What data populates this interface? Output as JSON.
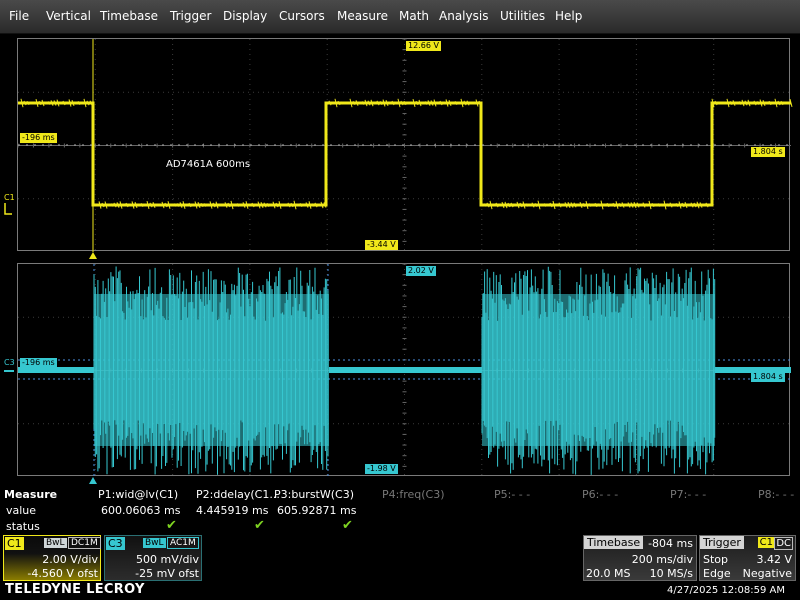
{
  "menu": [
    "File",
    "Vertical",
    "Timebase",
    "Trigger",
    "Display",
    "Cursors",
    "Measure",
    "Math",
    "Analysis",
    "Utilities",
    "Help"
  ],
  "grid1": {
    "top_level_label": "12.66 V",
    "bottom_level_label": "-3.44 V",
    "left_time_label": "-196 ms",
    "right_time_label": "1.804 s",
    "annotation": "AD7461A 600ms",
    "channel_tag": "C1",
    "color": "#f0e81a"
  },
  "grid2": {
    "top_level_label": "2.02 V",
    "bottom_level_label": "-1.98 V",
    "left_time_label": "-196 ms",
    "right_time_label": "1.804 s",
    "channel_tag": "C3",
    "color": "#36c7d0"
  },
  "measure": {
    "title": "Measure",
    "row_value": "value",
    "row_status": "status",
    "params": [
      {
        "name": "P1:wid@lv(C1)",
        "value": "600.06063 ms",
        "status": "✔"
      },
      {
        "name": "P2:ddelay(C1...",
        "value": "4.445919 ms",
        "status": "✔"
      },
      {
        "name": "P3:burstW(C3)",
        "value": "605.92871 ms",
        "status": "✔"
      },
      {
        "name": "P4:freq(C3)",
        "value": "",
        "status": ""
      },
      {
        "name": "P5:- - -",
        "value": "",
        "status": ""
      },
      {
        "name": "P6:- - -",
        "value": "",
        "status": ""
      },
      {
        "name": "P7:- - -",
        "value": "",
        "status": ""
      },
      {
        "name": "P8:- - -",
        "value": "",
        "status": ""
      }
    ]
  },
  "c1": {
    "label": "C1",
    "bw": "BwL",
    "coupling": "DC1M",
    "vdiv": "2.00 V/div",
    "offset": "-4.560 V ofst"
  },
  "c3": {
    "label": "C3",
    "bw": "BwL",
    "coupling": "AC1M",
    "vdiv": "500 mV/div",
    "offset": "-25 mV ofst"
  },
  "timebase": {
    "label": "Timebase",
    "delay": "-804 ms",
    "tdiv": "200 ms/div",
    "samples": "20.0 MS",
    "rate": "10 MS/s"
  },
  "trigger": {
    "label": "Trigger",
    "source": "C1",
    "coupling": "DC",
    "mode": "Stop",
    "level": "3.42 V",
    "type": "Edge",
    "slope": "Negative"
  },
  "brand": "TELEDYNE LECROY",
  "datetime": "4/27/2025 12:08:59 AM",
  "icons": {
    "trigger_marker": "triangle-up-icon",
    "check": "checkmark-icon"
  }
}
